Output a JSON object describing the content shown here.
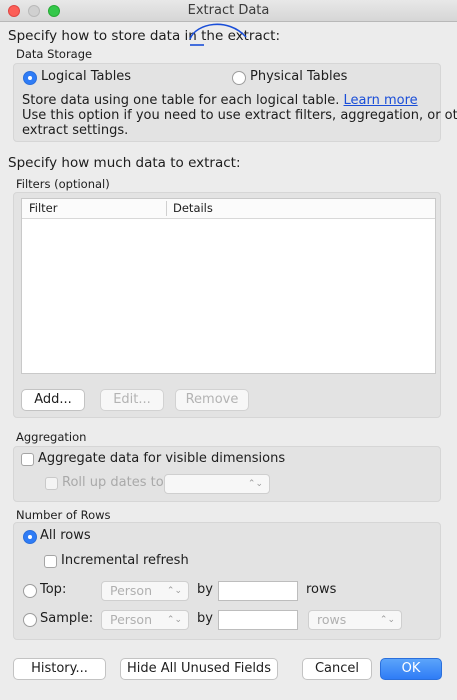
{
  "window": {
    "title": "Extract Data"
  },
  "storage": {
    "heading": "Specify how to store data in the extract:",
    "group_label": "Data Storage",
    "logical_label": "Logical Tables",
    "physical_label": "Physical Tables",
    "selected": "logical",
    "description_line1": "Store data using one table for each logical table.",
    "learn_more": "Learn more",
    "description_line2": "Use this option if you need to use extract filters, aggregation, or other",
    "description_line3": "extract settings."
  },
  "filters": {
    "heading": "Specify how much data to extract:",
    "group_label": "Filters (optional)",
    "columns": [
      "Filter",
      "Details"
    ],
    "rows": [],
    "add_button": "Add...",
    "edit_button": "Edit...",
    "remove_button": "Remove"
  },
  "aggregation": {
    "group_label": "Aggregation",
    "aggregate_label": "Aggregate data for visible dimensions",
    "rollup_label": "Roll up dates to",
    "rollup_value": ""
  },
  "rows": {
    "group_label": "Number of Rows",
    "all_rows_label": "All rows",
    "incremental_label": "Incremental refresh",
    "top_label": "Top:",
    "top_field": "Person",
    "by_label": "by",
    "rows_label": "rows",
    "sample_label": "Sample:",
    "sample_field": "Person",
    "sample_unit": "rows",
    "selected": "all"
  },
  "footer": {
    "history_button": "History...",
    "hide_fields_button": "Hide All Unused Fields",
    "cancel_button": "Cancel",
    "ok_button": "OK"
  },
  "colors": {
    "accent": "#2f7cf6",
    "link": "#1a4ed8",
    "annotation": "#1a4ed8"
  }
}
